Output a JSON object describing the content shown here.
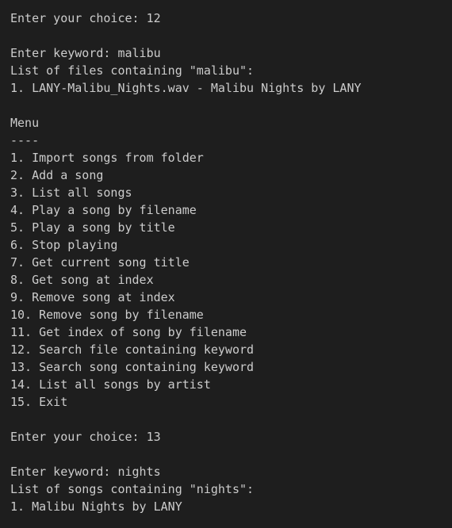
{
  "terminal": {
    "lines": [
      "Enter your choice: 12",
      "",
      "Enter keyword: malibu",
      "List of files containing \"malibu\":",
      "1. LANY-Malibu_Nights.wav - Malibu Nights by LANY",
      "",
      "Menu",
      "----",
      "1. Import songs from folder",
      "2. Add a song",
      "3. List all songs",
      "4. Play a song by filename",
      "5. Play a song by title",
      "6. Stop playing",
      "7. Get current song title",
      "8. Get song at index",
      "9. Remove song at index",
      "10. Remove song by filename",
      "11. Get index of song by filename",
      "12. Search file containing keyword",
      "13. Search song containing keyword",
      "14. List all songs by artist",
      "15. Exit",
      "",
      "Enter your choice: 13",
      "",
      "Enter keyword: nights",
      "List of songs containing \"nights\":",
      "1. Malibu Nights by LANY"
    ]
  },
  "colors": {
    "background": "#1e1e1e",
    "foreground": "#cccccc"
  }
}
